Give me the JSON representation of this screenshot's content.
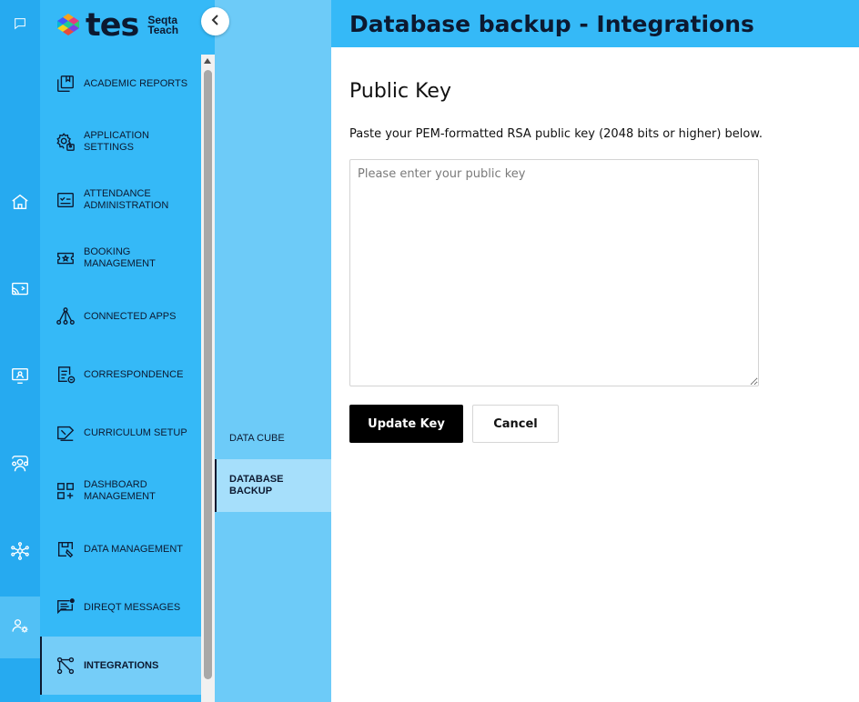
{
  "logo": {
    "word": "tes",
    "sub_line1": "Seqta",
    "sub_line2": "Teach"
  },
  "rail": [
    {
      "icon": "chat-icon"
    },
    {
      "icon": "home-icon"
    },
    {
      "icon": "cast-icon"
    },
    {
      "icon": "presentation-icon"
    },
    {
      "icon": "people-icon"
    },
    {
      "icon": "network-icon"
    },
    {
      "icon": "user-settings-icon",
      "active": true
    }
  ],
  "nav": {
    "items": [
      {
        "label": "Academic Reports",
        "icon": "report-icon"
      },
      {
        "label": "Application Settings",
        "icon": "settings-icon"
      },
      {
        "label": "Attendance Administration",
        "icon": "attendance-icon"
      },
      {
        "label": "Booking Management",
        "icon": "ticket-icon"
      },
      {
        "label": "Connected Apps",
        "icon": "connected-icon"
      },
      {
        "label": "Correspondence",
        "icon": "correspondence-icon"
      },
      {
        "label": "Curriculum Setup",
        "icon": "curriculum-icon"
      },
      {
        "label": "Dashboard Management",
        "icon": "dashboard-icon"
      },
      {
        "label": "Data Management",
        "icon": "data-icon"
      },
      {
        "label": "DireqT Messages",
        "icon": "messages-icon"
      },
      {
        "label": "Integrations",
        "icon": "integrations-icon",
        "active": true
      }
    ]
  },
  "sub": {
    "items": [
      {
        "label": "Data Cube"
      },
      {
        "label": "Database Backup",
        "active": true
      }
    ]
  },
  "header": {
    "title": "Database backup - Integrations"
  },
  "main": {
    "heading": "Public Key",
    "description": "Paste your PEM-formatted RSA public key (2048 bits or higher) below.",
    "key_placeholder": "Please enter your public key",
    "key_value": "",
    "update_label": "Update Key",
    "cancel_label": "Cancel"
  },
  "colors": {
    "rail": "#26aaf0",
    "nav": "#35b9f7",
    "sub": "#6dcbf8",
    "text_dark": "#0c1930",
    "primary_button": "#000000"
  }
}
